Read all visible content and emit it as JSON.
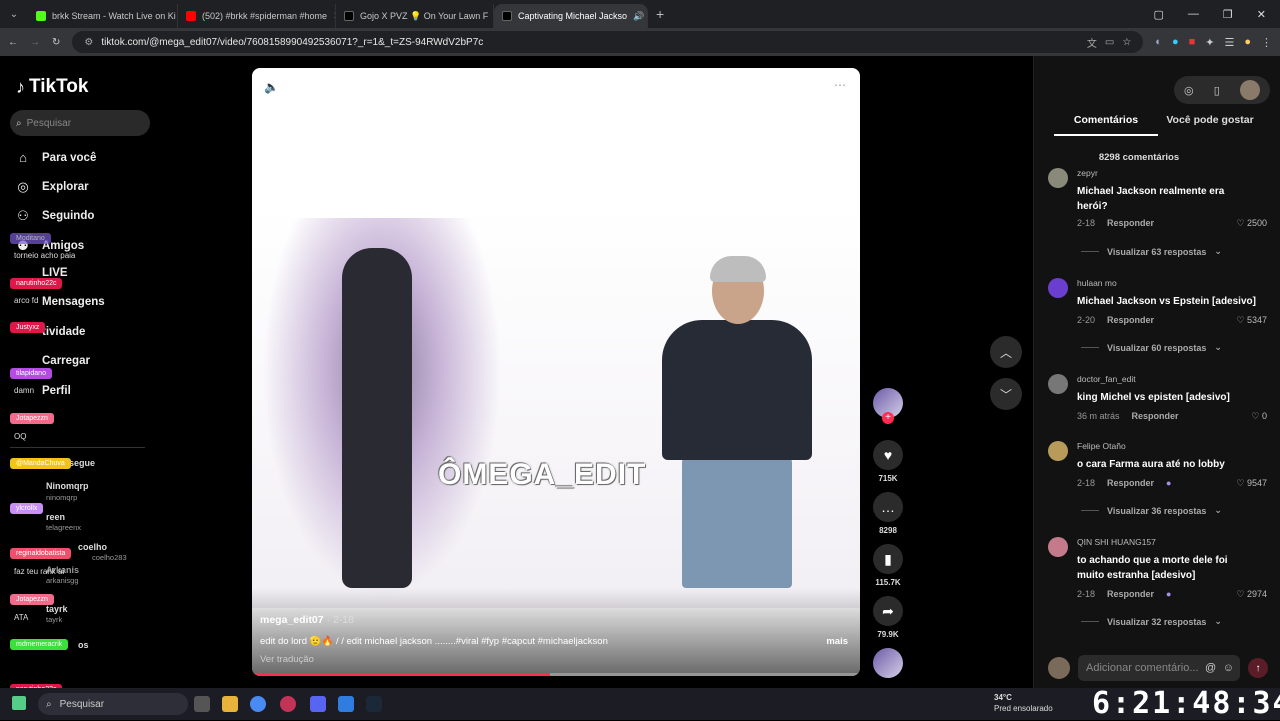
{
  "browser": {
    "tabs": [
      {
        "title": "brkk Stream - Watch Live on Ki",
        "color": "#53fc18"
      },
      {
        "title": "(502) #brkk #spiderman #home",
        "color": "#ff0000"
      },
      {
        "title": "Gojo X PVZ 💡 On Your Lawn F",
        "color": "#111111"
      },
      {
        "title": "Captivating Michael Jackso",
        "color": "#111111"
      }
    ],
    "url": "tiktok.com/@mega_edit07/video/7608158990492536071?_r=1&_t=ZS-94RWdV2bP7c"
  },
  "sidebar": {
    "logo": "TikTok",
    "search_placeholder": "Pesquisar",
    "nav": [
      {
        "label": "Para você",
        "icon": "home-icon"
      },
      {
        "label": "Explorar",
        "icon": "compass-icon"
      },
      {
        "label": "Seguindo",
        "icon": "following-icon"
      },
      {
        "label": "Amigos",
        "icon": "friends-icon"
      },
      {
        "label": "LIVE",
        "icon": "live-icon"
      },
      {
        "label": "Mensagens",
        "icon": "messages-icon"
      },
      {
        "label": "tividade",
        "icon": "activity-icon"
      },
      {
        "label": "Carregar",
        "icon": "upload-icon"
      },
      {
        "label": "Perfil",
        "icon": "profile-icon"
      },
      {
        "label": "s",
        "icon": "more-icon"
      }
    ],
    "following_title": "você segue",
    "following": [
      {
        "name": "Ninomqrp",
        "handle": "ninomqrp"
      },
      {
        "name": "reen",
        "handle": "telagreenx"
      },
      {
        "name": "coelho",
        "handle": "coelho283"
      },
      {
        "name": "Arkanis",
        "handle": "arkanisgg"
      },
      {
        "name": "tayrk",
        "handle": "tayrk"
      },
      {
        "name": "os",
        "handle": ""
      }
    ],
    "chat_overlay": [
      {
        "user": "Moditano",
        "msg": "torneio acho paia",
        "color": "#7b5bd6"
      },
      {
        "user": "narutinho22c",
        "msg": "arco fd",
        "color": "#e0184a"
      },
      {
        "user": "Justyxz",
        "msg": "",
        "color": "#e0184a"
      },
      {
        "user": "tilapidano",
        "msg": "damn",
        "color": "#b44be3"
      },
      {
        "user": "Jotapezzn",
        "msg": "OQ",
        "color": "#f06c8a"
      },
      {
        "user": "@MandaChuva",
        "msg": "",
        "color": "#f0c419"
      },
      {
        "user": "ylcrollx",
        "msg": "",
        "color": "#c890f5"
      },
      {
        "user": "reginaldobatista",
        "msg": "faz teu rank ai",
        "color": "#f0506e"
      },
      {
        "user": "Jotapezzn",
        "msg": "ATA",
        "color": "#f06c8a"
      },
      {
        "user": "mdmemeracrik",
        "msg": "",
        "color": "#3be03b"
      },
      {
        "user": "narutinho22c",
        "msg": "",
        "color": "#e0184a"
      }
    ]
  },
  "video": {
    "watermark": "ÔMEGA_EDIT",
    "author": "mega_edit07",
    "date": "2-18",
    "caption": "edit do lord 🫡🔥 / / edit michael jackson ........#viral #fyp #capcut #michaeljackson",
    "more": "mais",
    "translate": "Ver tradução",
    "progress": 0.49
  },
  "actions": {
    "likes": "715K",
    "comments": "8298",
    "saves": "115.7K",
    "shares": "79.9K"
  },
  "comments_panel": {
    "tab_comments": "Comentários",
    "tab_suggested": "Você pode gostar",
    "count_text": "8298 comentários",
    "comments": [
      {
        "user": "zepyr",
        "text": "Michael Jackson realmente era herói?",
        "date": "2-18",
        "reply": "Responder",
        "likes": "2500",
        "views": "Visualizar 63 respostas",
        "avatar": "#8a8a7a",
        "emoji": false
      },
      {
        "user": "hulaan mo",
        "text": "Michael Jackson vs Epstein [adesivo]",
        "date": "2-20",
        "reply": "Responder",
        "likes": "5347",
        "views": "Visualizar 60 respostas",
        "avatar": "#6a3fd0",
        "emoji": false
      },
      {
        "user": "doctor_fan_edit",
        "text": "king Michel vs episten [adesivo]",
        "date": "36 m atrás",
        "reply": "Responder",
        "likes": "0",
        "views": "",
        "avatar": "#777777",
        "emoji": false
      },
      {
        "user": "Felipe Otaño",
        "text": "o cara Farma aura até no lobby",
        "date": "2-18",
        "reply": "Responder",
        "likes": "9547",
        "views": "Visualizar 36 respostas",
        "avatar": "#b89a5a",
        "emoji": true
      },
      {
        "user": "QIN SHI HUANG157",
        "text": "to achando que a morte dele foi muito estranha [adesivo]",
        "date": "2-18",
        "reply": "Responder",
        "likes": "2974",
        "views": "Visualizar 32 respostas",
        "avatar": "#c47a8a",
        "emoji": true
      }
    ],
    "add_placeholder": "Adicionar comentário..."
  },
  "taskbar": {
    "search": "Pesquisar",
    "weather_temp": "34°C",
    "weather_desc": "Pred ensolarado",
    "clock": "6:21:48:34"
  }
}
